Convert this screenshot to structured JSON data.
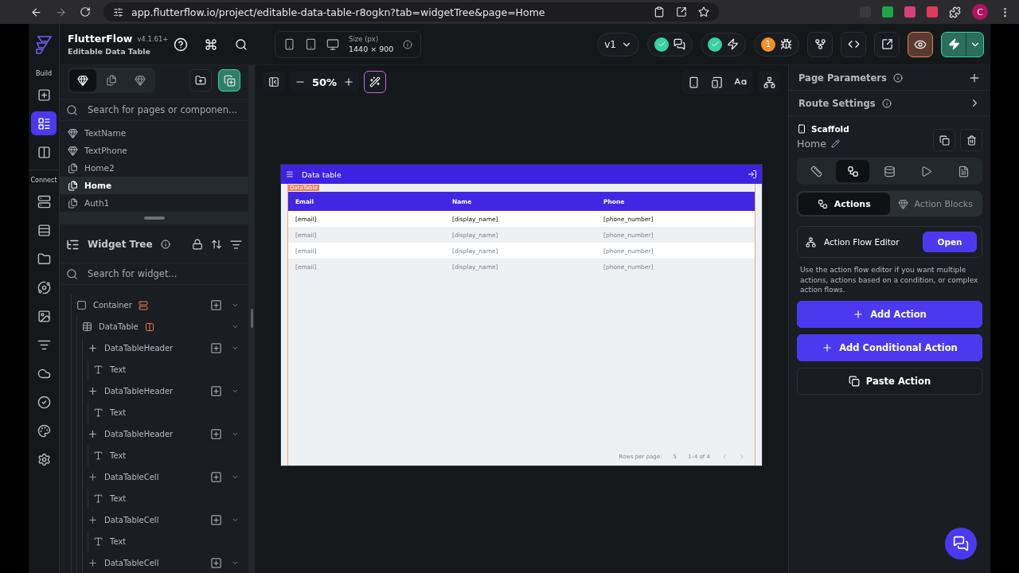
{
  "browser": {
    "url": "app.flutterflow.io/project/editable-data-table-r8ogkn?tab=widgetTree&page=Home",
    "profile_initial": "C"
  },
  "app_bar": {
    "brand": "FlutterFlow",
    "version": "v4.1.61+",
    "project": "Editable Data Table",
    "size_label": "Size (px)",
    "size_value": "1440 × 900",
    "branch": "v1",
    "issue_count": "1"
  },
  "rail": [
    {
      "label": "Build",
      "items": [
        {
          "kind": "add_widget",
          "selected": false
        },
        {
          "kind": "widget_tree",
          "selected": true
        },
        {
          "kind": "storyboard",
          "selected": false
        }
      ]
    },
    {
      "label": "Connect",
      "items": [
        {
          "kind": "firestore",
          "selected": false
        },
        {
          "kind": "data_types",
          "selected": false
        },
        {
          "kind": "storage",
          "selected": false
        },
        {
          "kind": "api",
          "selected": false
        },
        {
          "kind": "media",
          "selected": false
        },
        {
          "kind": "app_values",
          "selected": false
        },
        {
          "kind": "cloud",
          "selected": false
        },
        {
          "kind": "tests",
          "selected": false
        },
        {
          "kind": "theme",
          "selected": false
        },
        {
          "kind": "settings",
          "selected": false
        }
      ]
    }
  ],
  "pages_panel": {
    "tabs": [
      {
        "kind": "pages_components",
        "selected": true
      },
      {
        "kind": "pages",
        "selected": false
      },
      {
        "kind": "components",
        "selected": false
      }
    ],
    "search_placeholder": "Search for pages or componen...",
    "items": [
      {
        "label": "TextName",
        "kind": "component",
        "selected": false
      },
      {
        "label": "TextPhone",
        "kind": "component",
        "selected": false
      },
      {
        "label": "Home2",
        "kind": "page",
        "selected": false
      },
      {
        "label": "Home",
        "kind": "page",
        "selected": true
      },
      {
        "label": "Auth1",
        "kind": "page",
        "selected": false
      }
    ]
  },
  "widget_tree": {
    "title": "Widget Tree",
    "search_placeholder": "Search for widget...",
    "nodes": [
      {
        "label": "Container",
        "kind": "container",
        "children": [
          {
            "label": "DataTable",
            "kind": "data_table",
            "children": [
              {
                "label": "DataTableHeader",
                "kind": "header",
                "children": [
                  {
                    "label": "Text",
                    "kind": "text"
                  }
                ]
              },
              {
                "label": "DataTableHeader",
                "kind": "header",
                "children": [
                  {
                    "label": "Text",
                    "kind": "text"
                  }
                ]
              },
              {
                "label": "DataTableHeader",
                "kind": "header",
                "children": [
                  {
                    "label": "Text",
                    "kind": "text"
                  }
                ]
              },
              {
                "label": "DataTableCell",
                "kind": "cell",
                "children": [
                  {
                    "label": "Text",
                    "kind": "text"
                  }
                ]
              },
              {
                "label": "DataTableCell",
                "kind": "cell",
                "children": [
                  {
                    "label": "Text",
                    "kind": "text"
                  }
                ]
              },
              {
                "label": "DataTableCell",
                "kind": "cell"
              }
            ]
          }
        ]
      }
    ]
  },
  "canvas": {
    "zoom": "50%",
    "app_title": "Data table",
    "table_tag": "DataTable",
    "columns": [
      "Email",
      "Name",
      "Phone"
    ],
    "rows": [
      {
        "cells": [
          "[email]",
          "[display_name]",
          "[phone_number]"
        ],
        "dimmed": false
      },
      {
        "cells": [
          "[email]",
          "[display_name]",
          "[phone_number]"
        ],
        "dimmed": true
      },
      {
        "cells": [
          "[email]",
          "[display_name]",
          "[phone_number]"
        ],
        "dimmed": true
      },
      {
        "cells": [
          "[email]",
          "[display_name]",
          "[phone_number]"
        ],
        "dimmed": true
      }
    ],
    "footer": {
      "rows_per_page_label": "Rows per page:",
      "rows_per_page": "5",
      "range": "1–4 of 4"
    }
  },
  "properties": {
    "page_parameters": "Page Parameters",
    "route_settings": "Route Settings",
    "widget_type": "Scaffold",
    "widget_name": "Home",
    "tabs": [
      {
        "kind": "properties",
        "selected": false
      },
      {
        "kind": "actions",
        "selected": true
      },
      {
        "kind": "backend",
        "selected": false
      },
      {
        "kind": "animations",
        "selected": false
      },
      {
        "kind": "docs",
        "selected": false
      }
    ],
    "modes": [
      {
        "label": "Actions",
        "kind": "actions",
        "selected": true
      },
      {
        "label": "Action Blocks",
        "kind": "blocks",
        "selected": false
      }
    ],
    "flow_editor": {
      "label": "Action Flow Editor",
      "button": "Open"
    },
    "hint": "Use the action flow editor if you want multiple actions, actions based on a condition, or complex action flows.",
    "buttons": [
      {
        "label": "Add Action",
        "kind": "primary"
      },
      {
        "label": "Add Conditional Action",
        "kind": "primary"
      },
      {
        "label": "Paste Action",
        "kind": "paste"
      }
    ]
  }
}
